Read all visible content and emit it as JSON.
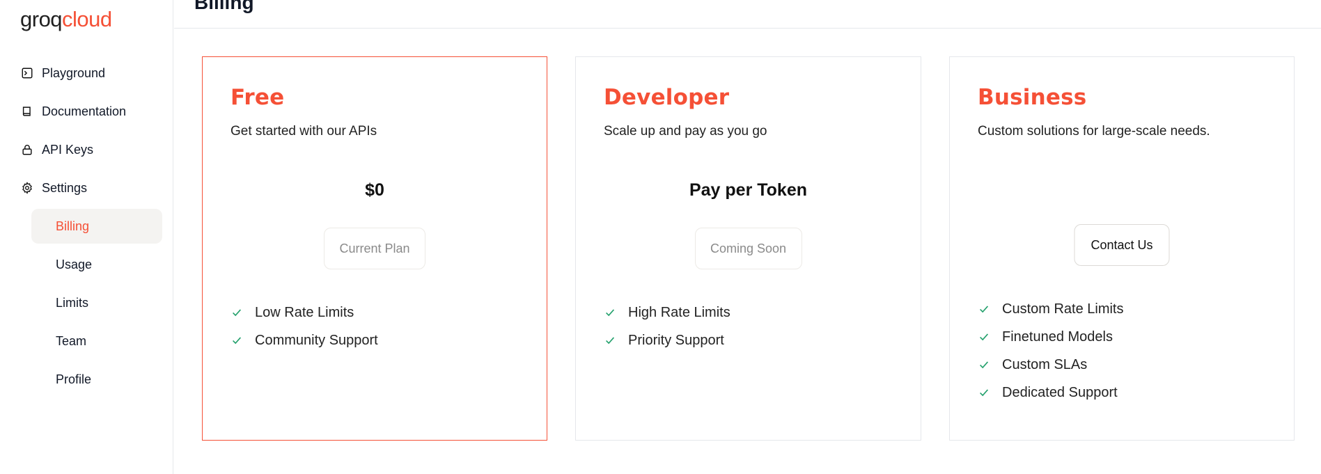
{
  "logo": {
    "part1": "groq",
    "part2": "cloud"
  },
  "nav": {
    "items": [
      {
        "label": "Playground",
        "icon": "terminal-icon"
      },
      {
        "label": "Documentation",
        "icon": "book-icon"
      },
      {
        "label": "API Keys",
        "icon": "lock-icon"
      },
      {
        "label": "Settings",
        "icon": "gear-icon"
      }
    ],
    "sub_items": [
      {
        "label": "Billing",
        "active": true
      },
      {
        "label": "Usage",
        "active": false
      },
      {
        "label": "Limits",
        "active": false
      },
      {
        "label": "Team",
        "active": false
      },
      {
        "label": "Profile",
        "active": false
      }
    ]
  },
  "header": {
    "title": "Billing"
  },
  "plans": [
    {
      "name": "Free",
      "description": "Get started with our APIs",
      "price": "$0",
      "button": "Current Plan",
      "features": [
        "Low Rate Limits",
        "Community Support"
      ]
    },
    {
      "name": "Developer",
      "description": "Scale up and pay as you go",
      "price": "Pay per Token",
      "button": "Coming Soon",
      "features": [
        "High Rate Limits",
        "Priority Support"
      ]
    },
    {
      "name": "Business",
      "description": "Custom solutions for large-scale needs.",
      "price": "",
      "button": "Contact Us",
      "features": [
        "Custom Rate Limits",
        "Finetuned Models",
        "Custom SLAs",
        "Dedicated Support"
      ]
    }
  ],
  "colors": {
    "accent": "#f55036",
    "check": "#22a06b",
    "active_bg": "#f4f3f1"
  }
}
